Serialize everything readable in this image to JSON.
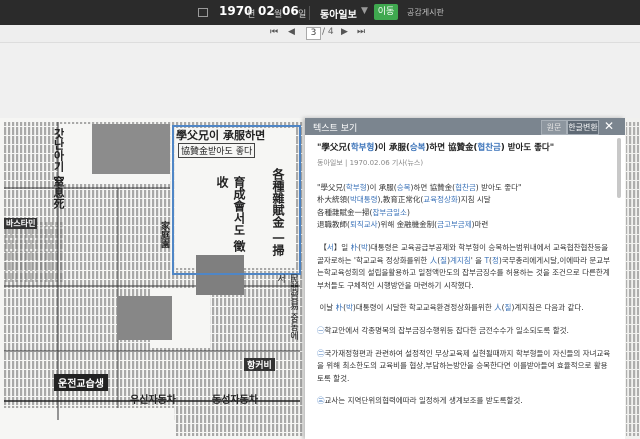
{
  "toolbar": {
    "year": "1970",
    "year_unit": "년",
    "month": "02",
    "month_unit": "월",
    "day": "06",
    "day_unit": "일",
    "newspaper": "동아일보",
    "go_label": "이동",
    "notice_label": "공감게시판"
  },
  "pager": {
    "current_page": "3",
    "total_pages": "/ 4"
  },
  "newspaper_scan": {
    "headlines": {
      "h1": "學父兄이 承服하면",
      "h2": "協贊金받아도 좋다",
      "h3": "育成會서도 徵收",
      "h4": "各種雜賦金 一掃",
      "h5": "民間貿易 중동에서",
      "h6": "갓난아기 窒息死",
      "h7": "운전교습생",
      "h8": "우신자동차",
      "h9": "동성자동차",
      "h10": "바스타민",
      "h11": "항커비",
      "h12": "家庭園"
    }
  },
  "text_panel": {
    "title": "텍스트 보기",
    "btn_original": "원문",
    "btn_hangul": "한글변환",
    "close_glyph": "✕",
    "article_title": {
      "p1": "\"學父兄(",
      "h1": "학부형",
      "p2": ")이 承服(",
      "h2": "승복",
      "p3": ")하면 協贊金(",
      "h3": "협찬금",
      "p4": ") 받아도 좋다\""
    },
    "meta": "동아일보 | 1970.02.06 기사(뉴스)",
    "para1": {
      "p1": "\"學父兄(",
      "h1": "학부형",
      "p2": ")이 承服(",
      "h2": "승복",
      "p3": ")하면 協贊金(",
      "h3": "협찬금",
      "p4": ") 받아도 좋다\"",
      "p5": "朴大統領(",
      "h4": "박대통령",
      "p6": "),教育正常化(",
      "h5": "교육정상화",
      "p7": ")지침 시달",
      "p8": "各種雜賦金一掃(",
      "h6": "잡부금일소",
      "p9": ")",
      "p10": "退職教師(",
      "h7": "퇴직교사",
      "p11": ")위해 金融機金制(",
      "h8": "금고부금제",
      "p12": ")마련"
    },
    "para2": {
      "p1": "【",
      "h1": "서",
      "p2": "】일 ",
      "h2": "朴",
      "p3": "(",
      "h3": "박",
      "p4": ")대통령은 교육공급부공제와 학부형이 승복하는범위내에서 교육협찬협찬등을 골자로하는 '학교교육 정상화를위한 ",
      "h4": "人",
      "p5": "(",
      "h5": "질",
      "p6": ")",
      "h6": "계지침",
      "p7": "' 을 ",
      "h7": "T",
      "p8": "(",
      "h8": "정",
      "p9": ")국무총리에게시달,이에따라 문교부는학교육성회의 설립을활용하고 일정액만도의 잡부금징수를 허용하는 것을 조건으로 다른한계부처들도 구체적인 시행방안을 마련하기 시작했다."
    },
    "para3": {
      "p1": "이날 ",
      "h1": "朴",
      "p2": "(",
      "h2": "박",
      "p3": ")대통령이 시달한 학교교육환경정상화를위한 ",
      "h3": "人",
      "p4": "(",
      "h4": "질",
      "p5": ")계지침은 다음과 같다."
    },
    "para4": {
      "h1": "㊀",
      "p1": "학교안에서 각종명목의 잡부금징수행위등 잡다한 금전수수가 일소되도록 할것."
    },
    "para5": {
      "h1": "㊁",
      "p1": "국가재정형편과 관련하여 설정적인 무상교육제 실현될때까지 학부형들이 자신들의 자녀교육을 위해 최소한도의 교육비를 협상,부담하는방안을 승복한다면 이를받아들여 효율적으로 활용토록 할것."
    },
    "para6": {
      "h1": "㊂",
      "p1": "교사는 지역단위의협력에따라 일정하게 생계보조를 받도록할것."
    }
  },
  "colors": {
    "topbar_bg": "#2b2b2b",
    "go_button": "#3fa84f",
    "panel_header": "#7b858f",
    "hanja_reading": "#3b73b9",
    "highlight_box": "#4f86c6"
  }
}
